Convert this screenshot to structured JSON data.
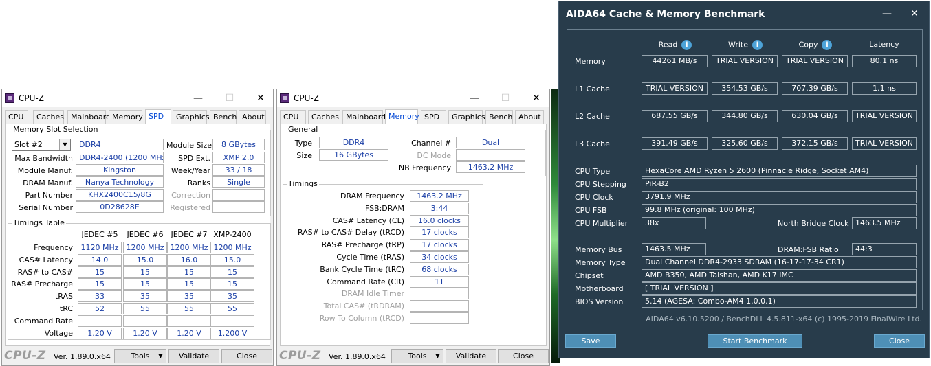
{
  "cpuz1": {
    "title": "CPU-Z",
    "min_glyph": "—",
    "max_glyph": "☐",
    "close_glyph": "✕",
    "tabs": [
      "CPU",
      "Caches",
      "Mainboard",
      "Memory",
      "SPD",
      "Graphics",
      "Bench",
      "About"
    ],
    "active_tab": "SPD",
    "slot_group_title": "Memory Slot Selection",
    "slot_selected": "Slot #2",
    "memory_type": "DDR4",
    "labels": {
      "module_size": "Module Size",
      "max_bandwidth": "Max Bandwidth",
      "spd_ext": "SPD Ext.",
      "module_manuf": "Module Manuf.",
      "week_year": "Week/Year",
      "dram_manuf": "DRAM Manuf.",
      "ranks": "Ranks",
      "part_number": "Part Number",
      "correction": "Correction",
      "serial_number": "Serial Number",
      "registered": "Registered"
    },
    "values": {
      "module_size": "8 GBytes",
      "max_bandwidth": "DDR4-2400 (1200 MHz)",
      "spd_ext": "XMP 2.0",
      "module_manuf": "Kingston",
      "week_year": "33 / 18",
      "dram_manuf": "Nanya Technology",
      "ranks": "Single",
      "part_number": "KHX2400C15/8G",
      "correction": "",
      "serial_number": "0D28628E",
      "registered": ""
    },
    "timings_title": "Timings Table",
    "timings_columns": [
      "JEDEC #5",
      "JEDEC #6",
      "JEDEC #7",
      "XMP-2400"
    ],
    "timings_rows": [
      {
        "label": "Frequency",
        "values": [
          "1120 MHz",
          "1200 MHz",
          "1200 MHz",
          "1200 MHz"
        ]
      },
      {
        "label": "CAS# Latency",
        "values": [
          "14.0",
          "15.0",
          "16.0",
          "15.0"
        ]
      },
      {
        "label": "RAS# to CAS#",
        "values": [
          "15",
          "15",
          "15",
          "15"
        ]
      },
      {
        "label": "RAS# Precharge",
        "values": [
          "15",
          "15",
          "15",
          "15"
        ]
      },
      {
        "label": "tRAS",
        "values": [
          "33",
          "35",
          "35",
          "35"
        ]
      },
      {
        "label": "tRC",
        "values": [
          "52",
          "55",
          "55",
          "55"
        ]
      },
      {
        "label": "Command Rate",
        "values": [
          "",
          "",
          "",
          ""
        ]
      },
      {
        "label": "Voltage",
        "values": [
          "1.20 V",
          "1.20 V",
          "1.20 V",
          "1.200 V"
        ]
      }
    ],
    "brand": "CPU-Z",
    "version": "Ver. 1.89.0.x64",
    "tools_label": "Tools",
    "validate_label": "Validate",
    "close_label": "Close"
  },
  "cpuz2": {
    "title": "CPU-Z",
    "min_glyph": "—",
    "max_glyph": "☐",
    "close_glyph": "✕",
    "tabs": [
      "CPU",
      "Caches",
      "Mainboard",
      "Memory",
      "SPD",
      "Graphics",
      "Bench",
      "About"
    ],
    "active_tab": "Memory",
    "general_title": "General",
    "labels": {
      "type": "Type",
      "size": "Size",
      "channel": "Channel #",
      "dc_mode": "DC Mode",
      "nb_frequency": "NB Frequency"
    },
    "values": {
      "type": "DDR4",
      "size": "16 GBytes",
      "channel": "Dual",
      "dc_mode": "",
      "nb_frequency": "1463.2 MHz"
    },
    "timings_title": "Timings",
    "timings": [
      {
        "label": "DRAM Frequency",
        "value": "1463.2 MHz",
        "disabled": false
      },
      {
        "label": "FSB:DRAM",
        "value": "3:44",
        "disabled": false
      },
      {
        "label": "CAS# Latency (CL)",
        "value": "16.0 clocks",
        "disabled": false
      },
      {
        "label": "RAS# to CAS# Delay (tRCD)",
        "value": "17 clocks",
        "disabled": false
      },
      {
        "label": "RAS# Precharge (tRP)",
        "value": "17 clocks",
        "disabled": false
      },
      {
        "label": "Cycle Time (tRAS)",
        "value": "34 clocks",
        "disabled": false
      },
      {
        "label": "Bank Cycle Time (tRC)",
        "value": "68 clocks",
        "disabled": false
      },
      {
        "label": "Command Rate (CR)",
        "value": "1T",
        "disabled": false
      },
      {
        "label": "DRAM Idle Timer",
        "value": "",
        "disabled": true
      },
      {
        "label": "Total CAS# (tRDRAM)",
        "value": "",
        "disabled": true
      },
      {
        "label": "Row To Column (tRCD)",
        "value": "",
        "disabled": true
      }
    ],
    "brand": "CPU-Z",
    "version": "Ver. 1.89.0.x64",
    "tools_label": "Tools",
    "validate_label": "Validate",
    "close_label": "Close"
  },
  "aida": {
    "title": "AIDA64 Cache & Memory Benchmark",
    "min_glyph": "—",
    "close_glyph": "✕",
    "info_glyph": "i",
    "columns": [
      "Read",
      "Write",
      "Copy",
      "Latency"
    ],
    "bench_rows": [
      {
        "label": "Memory",
        "values": [
          "44261 MB/s",
          "TRIAL VERSION",
          "TRIAL VERSION",
          "80.1 ns"
        ]
      },
      {
        "label": "L1 Cache",
        "values": [
          "TRIAL VERSION",
          "354.53 GB/s",
          "707.39 GB/s",
          "1.1 ns"
        ]
      },
      {
        "label": "L2 Cache",
        "values": [
          "687.55 GB/s",
          "344.80 GB/s",
          "630.04 GB/s",
          "TRIAL VERSION"
        ]
      },
      {
        "label": "L3 Cache",
        "values": [
          "391.49 GB/s",
          "325.60 GB/s",
          "372.15 GB/s",
          "TRIAL VERSION"
        ]
      }
    ],
    "cpu_type_label": "CPU Type",
    "cpu_type": "HexaCore AMD Ryzen 5 2600  (Pinnacle Ridge, Socket AM4)",
    "cpu_stepping_label": "CPU Stepping",
    "cpu_stepping": "PiR-B2",
    "cpu_clock_label": "CPU Clock",
    "cpu_clock": "3791.9 MHz",
    "cpu_fsb_label": "CPU FSB",
    "cpu_fsb": "99.8 MHz  (original: 100 MHz)",
    "cpu_multiplier_label": "CPU Multiplier",
    "cpu_multiplier": "38x",
    "nb_clock_label": "North Bridge Clock",
    "nb_clock": "1463.5 MHz",
    "memory_bus_label": "Memory Bus",
    "memory_bus": "1463.5 MHz",
    "dram_fsb_label": "DRAM:FSB Ratio",
    "dram_fsb": "44:3",
    "memory_type_label": "Memory Type",
    "memory_type": "Dual Channel DDR4-2933 SDRAM  (16-17-17-34 CR1)",
    "chipset_label": "Chipset",
    "chipset": "AMD B350, AMD Taishan, AMD K17 IMC",
    "motherboard_label": "Motherboard",
    "motherboard": "[ TRIAL VERSION ]",
    "bios_label": "BIOS Version",
    "bios": "5.14  (AGESA: Combo-AM4 1.0.0.1)",
    "footer": "AIDA64 v6.10.5200 / BenchDLL 4.5.811-x64  (c) 1995-2019 FinalWire Ltd.",
    "save_label": "Save",
    "start_label": "Start Benchmark",
    "close_label": "Close"
  }
}
